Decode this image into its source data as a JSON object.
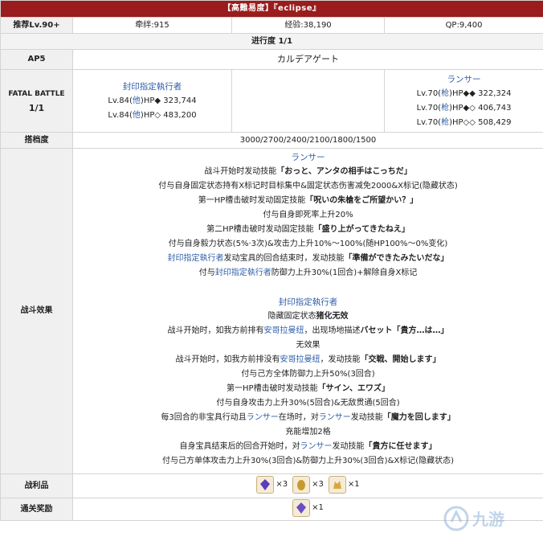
{
  "title": "【高難易度】『eclipse』",
  "row_info": {
    "label": "推荐Lv.90+",
    "bond": "牵绊:915",
    "exp": "经验:38,190",
    "qp": "QP:9,400"
  },
  "progress": "进行度 1/1",
  "ap": {
    "label": "AP5",
    "value": "カルデアゲート"
  },
  "fatal": {
    "label_line1": "FATAL BATTLE",
    "label_line2": "1/1",
    "left": {
      "name": "封印指定執行者",
      "lines": [
        {
          "pre": "Lv.84(",
          "cls": "他",
          "post": ")HP◆ 323,744"
        },
        {
          "pre": "Lv.84(",
          "cls": "他",
          "post": ")HP◇ 483,200"
        }
      ]
    },
    "right": {
      "name": "ランサー",
      "lines": [
        {
          "pre": "Lv.70(",
          "cls": "枪",
          "post": ")HP◆◆ 322,324"
        },
        {
          "pre": "Lv.70(",
          "cls": "枪",
          "post": ")HP◆◇ 406,743"
        },
        {
          "pre": "Lv.70(",
          "cls": "枪",
          "post": ")HP◇◇ 508,429"
        }
      ]
    }
  },
  "bond_ce": {
    "label": "搭档度",
    "value": "3000/2700/2400/2100/1800/1500"
  },
  "effects": {
    "label": "战斗效果",
    "lancer_name": "ランサー",
    "lancer_lines": [
      [
        {
          "t": "战斗开始时发动技能"
        },
        {
          "t": "「おっと、アンタの相手はこっちだ」",
          "b": true
        }
      ],
      [
        {
          "t": "付与自身固定状态持有X标记时目标集中&固定状态伤害减免2000&X标记(隐藏状态)"
        }
      ],
      [
        {
          "t": "第一HP槽击破时发动固定技能"
        },
        {
          "t": "「呪いの朱槍をご所望かい？」",
          "b": true
        }
      ],
      [
        {
          "t": "付与自身即死率上升20%"
        }
      ],
      [
        {
          "t": "第二HP槽击破时发动固定技能"
        },
        {
          "t": "「盛り上がってきたねえ」",
          "b": true
        }
      ],
      [
        {
          "t": "付与自身毅力状态(5%·3次)&攻击力上升10%～100%(随HP100%～0%变化)"
        }
      ],
      [
        {
          "t": "封印指定執行者",
          "c": "blue"
        },
        {
          "t": "发动宝具的回合结束时，发动技能"
        },
        {
          "t": "「準備ができたみたいだな」",
          "b": true
        }
      ],
      [
        {
          "t": "付与"
        },
        {
          "t": "封印指定執行者",
          "c": "blue"
        },
        {
          "t": "防御力上升30%(1回合)+解除自身X标记"
        }
      ]
    ],
    "enforcer_name": "封印指定執行者",
    "enforcer_lines": [
      [
        {
          "t": "隐藏固定状态"
        },
        {
          "t": "猪化无效",
          "b": true
        }
      ],
      [
        {
          "t": "战斗开始时，如我方前排有"
        },
        {
          "t": "安哥拉曼纽",
          "c": "blue"
        },
        {
          "t": "，出现场地描述"
        },
        {
          "t": "バセット「貴方…は…」",
          "b": true
        }
      ],
      [
        {
          "t": "无效果"
        }
      ],
      [
        {
          "t": "战斗开始时，如我方前排没有"
        },
        {
          "t": "安哥拉曼纽",
          "c": "blue"
        },
        {
          "t": "，发动技能"
        },
        {
          "t": "「交戦、開始します」",
          "b": true
        }
      ],
      [
        {
          "t": "付与己方全体防御力上升50%(3回合)"
        }
      ],
      [
        {
          "t": "第一HP槽击破时发动技能"
        },
        {
          "t": "「サイン、エワズ」",
          "b": true
        }
      ],
      [
        {
          "t": "付与自身攻击力上升30%(5回合)&无敌贯通(5回合)"
        }
      ],
      [
        {
          "t": "每3回合的非宝具行动且"
        },
        {
          "t": "ランサー",
          "c": "blue"
        },
        {
          "t": "在场时，对"
        },
        {
          "t": "ランサー",
          "c": "blue"
        },
        {
          "t": "发动技能"
        },
        {
          "t": "「魔力を回します」",
          "b": true
        }
      ],
      [
        {
          "t": "充能增加2格"
        }
      ],
      [
        {
          "t": "自身宝具结束后的回合开始时，对"
        },
        {
          "t": "ランサー",
          "c": "blue"
        },
        {
          "t": "发动技能"
        },
        {
          "t": "「貴方に任せます」",
          "b": true
        }
      ],
      [
        {
          "t": "付与己方单体攻击力上升30%(3回合)&防御力上升30%(3回合)&X标记(隐藏状态)"
        }
      ]
    ]
  },
  "drops": {
    "label": "战利品",
    "items": [
      {
        "icon": "purple-gem-icon",
        "qty": "×3",
        "color": "#5b3fb8"
      },
      {
        "icon": "golden-egg-icon",
        "qty": "×3",
        "color": "#c89a2a"
      },
      {
        "icon": "gold-piece-icon",
        "qty": "×1",
        "color": "#d9a83a"
      }
    ]
  },
  "reward": {
    "label": "通关奖励",
    "items": [
      {
        "icon": "purple-crystal-icon",
        "qty": "×1",
        "color": "#6a4fc4"
      }
    ]
  },
  "watermark": "九游"
}
